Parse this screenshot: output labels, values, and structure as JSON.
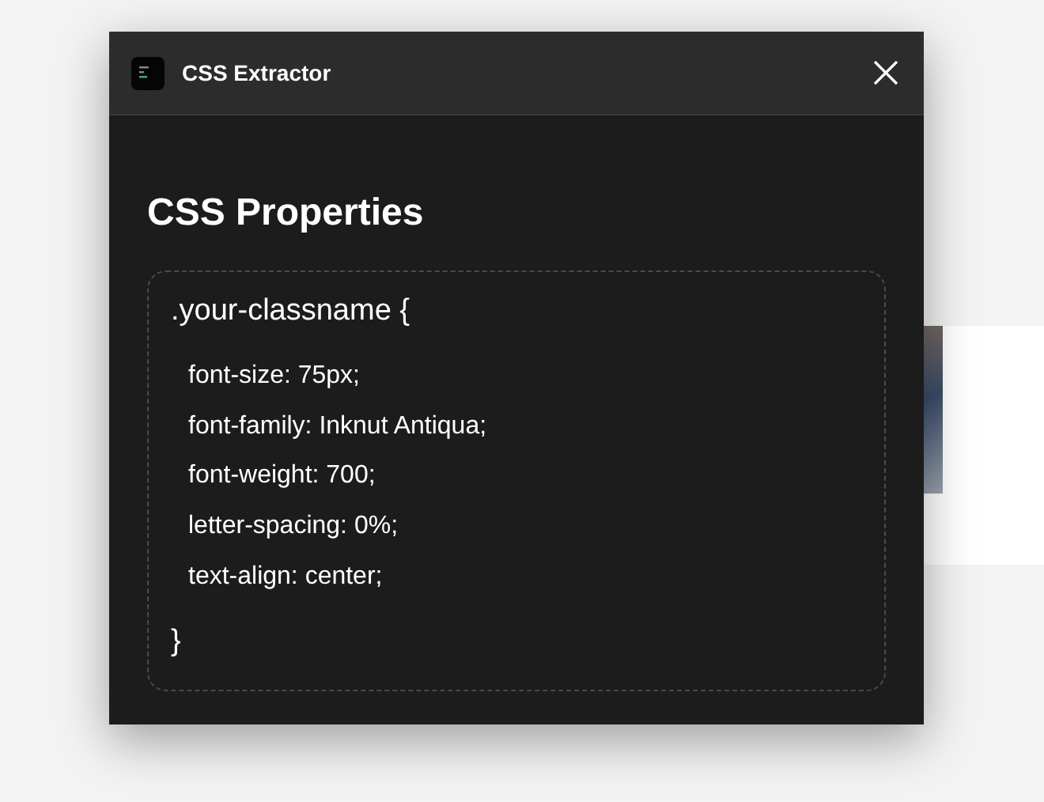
{
  "dialog": {
    "title": "CSS Extractor",
    "heading": "CSS Properties",
    "code": {
      "selector": ".your-classname {",
      "closing": "}",
      "properties": [
        {
          "text": "font-size: 75px;"
        },
        {
          "text": "font-family: Inknut Antiqua;"
        },
        {
          "text": "font-weight: 700;"
        },
        {
          "text": "letter-spacing: 0%;"
        },
        {
          "text": "text-align: center;"
        }
      ]
    }
  }
}
